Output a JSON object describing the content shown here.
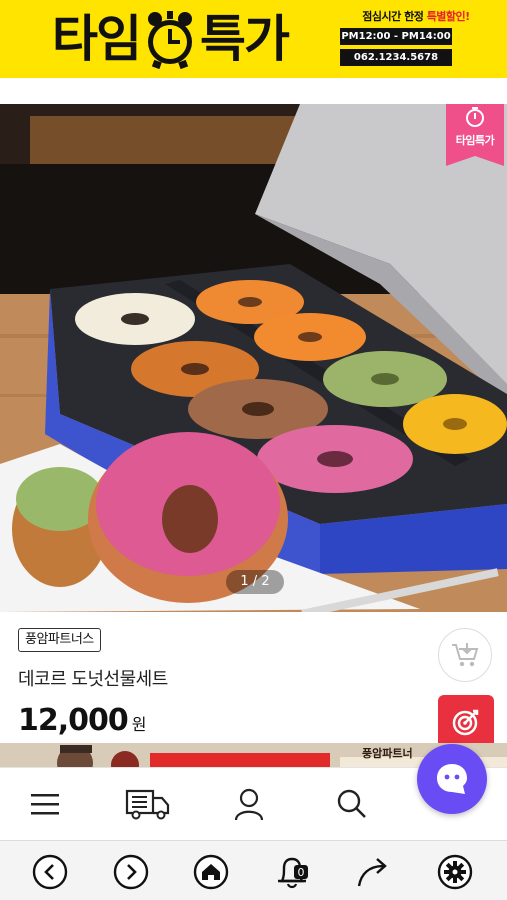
{
  "banner": {
    "title_a": "타임",
    "title_b": "특가",
    "promo_a": "점심시간 한정 ",
    "promo_b": "특별할인!",
    "time": "PM12:00 - PM14:00",
    "phone": "062.1234.5678",
    "bg_color": "#ffe400"
  },
  "hero": {
    "badge_label": "타임특가",
    "badge_color": "#f0508a",
    "counter": "1 / 2"
  },
  "product": {
    "seller": "풍암파트너스",
    "name": "데코르 도넛선물세트",
    "price": "12,000",
    "price_unit": "원",
    "accent_color": "#e8303f"
  },
  "peek": {
    "label": "풍암파트너"
  },
  "menu": {
    "items": [
      "menu-icon",
      "delivery-truck-icon",
      "user-icon",
      "search-icon"
    ],
    "chat_color": "#6a4cf5"
  },
  "browser_nav": {
    "items": [
      "back-icon",
      "forward-icon",
      "home-icon",
      "bell-icon",
      "share-icon",
      "settings-icon"
    ],
    "bell_count": "0"
  }
}
